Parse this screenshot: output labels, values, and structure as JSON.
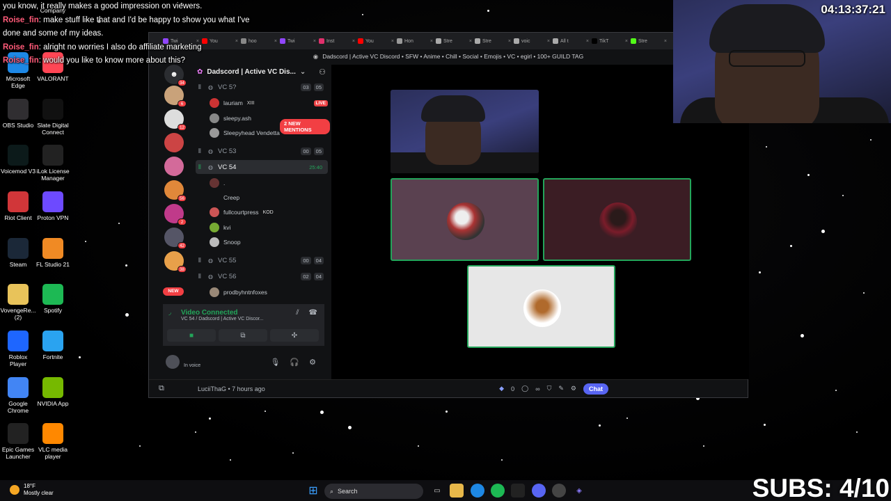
{
  "chat_overlay": [
    {
      "user": "",
      "text": "you know, it really makes a good impression on viewers."
    },
    {
      "user": "Roise_fin",
      "text": ": make stuff like that and I'd be happy to show you what I've"
    },
    {
      "user": "",
      "text": "done and some of my ideas."
    },
    {
      "user": "Roise_fin",
      "text": ": alright no worries I also do affiliate marketing"
    },
    {
      "user": "Roise_fin",
      "text": ": would you like to know more about this?"
    }
  ],
  "desktop_icons": [
    {
      "label": "Company",
      "color": "#d04040"
    },
    {
      "label": "Microsoft Edge",
      "color": "#1e88e5"
    },
    {
      "label": "VALORANT",
      "color": "#ff4655"
    },
    {
      "label": "OBS Studio",
      "color": "#302e31"
    },
    {
      "label": "Slate Digital Connect",
      "color": "#111"
    },
    {
      "label": "Voicemod V3",
      "color": "#0c1a1a"
    },
    {
      "label": "iLok License Manager",
      "color": "#222"
    },
    {
      "label": "Riot Client",
      "color": "#d13639"
    },
    {
      "label": "Proton VPN",
      "color": "#6d4aff"
    },
    {
      "label": "Steam",
      "color": "#1b2838"
    },
    {
      "label": "FL Studio 21",
      "color": "#f08a24"
    },
    {
      "label": "VovengeRe... (2)",
      "color": "#e8c35a"
    },
    {
      "label": "Spotify",
      "color": "#1db954"
    },
    {
      "label": "Roblox Player",
      "color": "#1e66ff"
    },
    {
      "label": "Fortnite",
      "color": "#2aa3f0"
    },
    {
      "label": "Google Chrome",
      "color": "#4285f4"
    },
    {
      "label": "NVIDIA App",
      "color": "#76b900"
    },
    {
      "label": "Epic Games Launcher",
      "color": "#222"
    },
    {
      "label": "VLC media player",
      "color": "#ff8800"
    }
  ],
  "stream_timer": "04:13:37:21",
  "subs_counter": "SUBS: 4/10",
  "browser_tabs": [
    "Twi",
    "You",
    "hoo",
    "Twi",
    "Inst",
    "You",
    "Hon",
    "Stre",
    "Stre",
    "voic",
    "All t",
    "TikT",
    "Stre"
  ],
  "window_title": "Dadscord | Active VC Discord • SFW • Anime • Chill • Social • Emojis • VC • egirl • 100+ GUILD TAG",
  "server": {
    "name": "Dadscord | Active VC Dis...",
    "mentions_pill": "2 NEW MENTIONS",
    "new_pill": "NEW",
    "top_badge": "34"
  },
  "server_badges": [
    "6",
    "12",
    "",
    "",
    "56",
    "2",
    "42",
    "38"
  ],
  "channels": {
    "vc53_top": {
      "name": "VC 5?",
      "a": "03",
      "b": "05"
    },
    "vc53": {
      "name": "VC 53",
      "a": "00",
      "b": "05"
    },
    "vc54": {
      "name": "VC 54",
      "time": "25:40"
    },
    "vc55": {
      "name": "VC 55",
      "a": "00",
      "b": "04"
    },
    "vc56": {
      "name": "VC 56",
      "a": "02",
      "b": "04"
    }
  },
  "members_top": [
    {
      "name": "lauriam",
      "tag": "XIII",
      "live": "LIVE"
    },
    {
      "name": "sleepy.ash"
    },
    {
      "name": "Sleepyhead Vendetta"
    }
  ],
  "members_vc54": [
    {
      "name": "."
    },
    {
      "name": "Creep"
    },
    {
      "name": "fullcourtpress",
      "tag": "KOD"
    },
    {
      "name": "kvi"
    },
    {
      "name": "Snoop"
    }
  ],
  "members_vc56": [
    {
      "name": "prodbyhntnfoxes"
    }
  ],
  "voice_panel": {
    "title": "Video Connected",
    "subtitle": "VC 54 / Dadscord | Active VC Discor..."
  },
  "user_panel": {
    "status": "In voice"
  },
  "bottom_bar": {
    "author": "LuciiThaG • 7 hours ago",
    "count": "0",
    "infinity": "∞",
    "chat_label": "Chat"
  },
  "taskbar": {
    "weather_temp": "18°F",
    "weather_desc": "Mostly clear",
    "search_label": "Search"
  },
  "colors": {
    "discord_bg": "#111214",
    "accent_green": "#23a55a",
    "mention_red": "#f23f43",
    "blurple": "#5865f2",
    "chat_username": "#ff5a78"
  }
}
